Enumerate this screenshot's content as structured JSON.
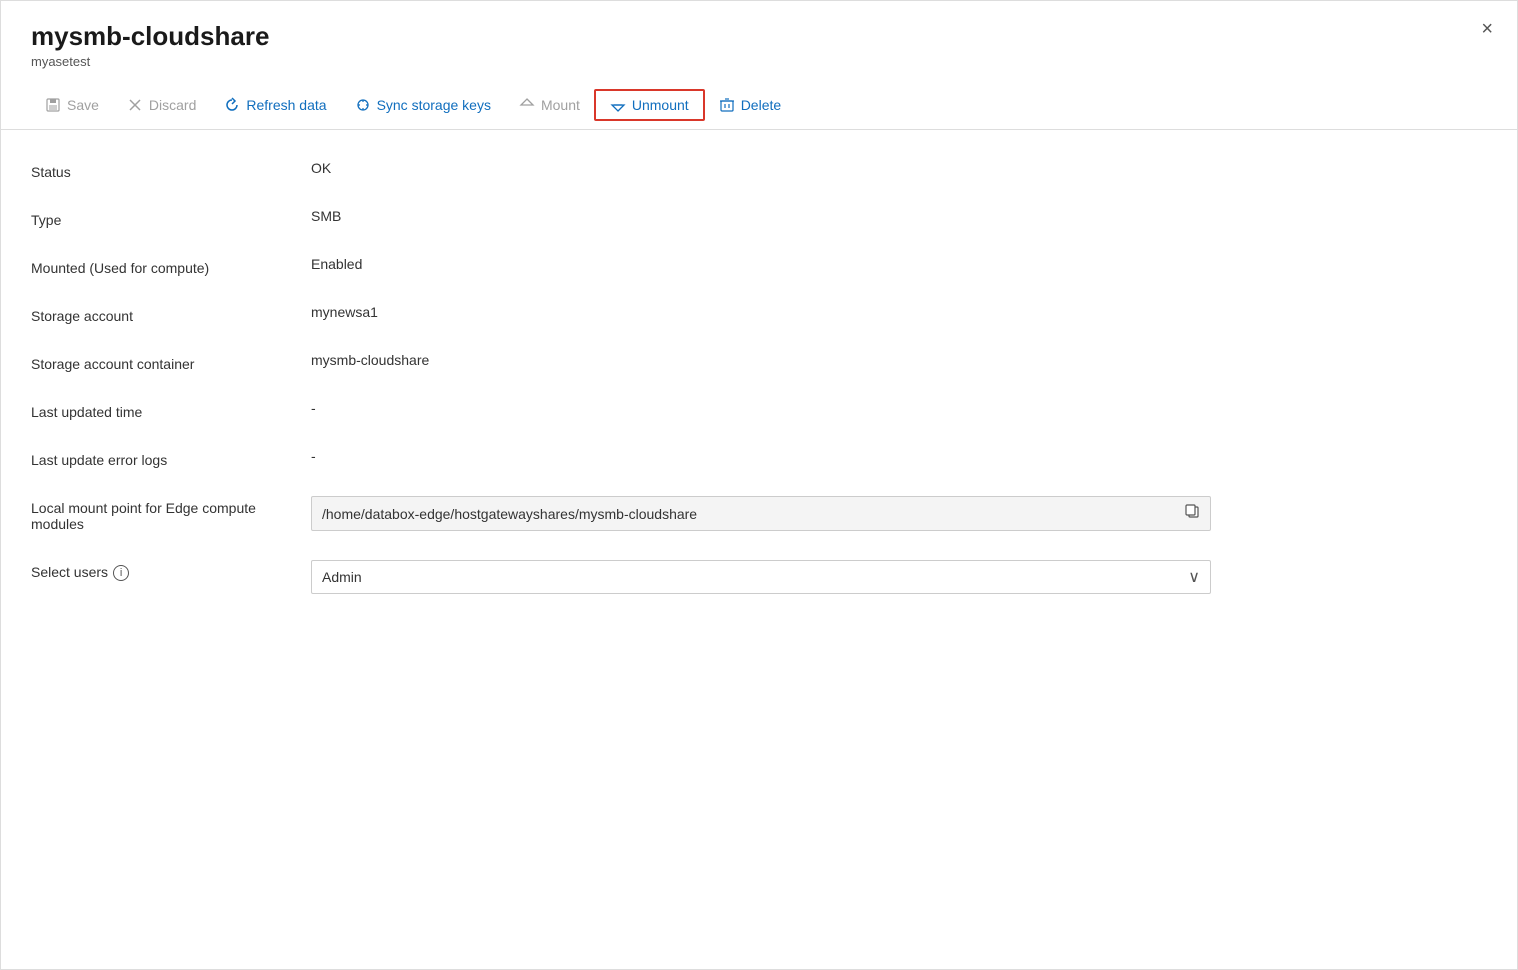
{
  "panel": {
    "title": "mysmb-cloudshare",
    "subtitle": "myasetest",
    "close_label": "×"
  },
  "toolbar": {
    "save_label": "Save",
    "discard_label": "Discard",
    "refresh_label": "Refresh data",
    "sync_label": "Sync storage keys",
    "mount_label": "Mount",
    "unmount_label": "Unmount",
    "delete_label": "Delete"
  },
  "fields": [
    {
      "label": "Status",
      "value": "OK",
      "type": "text"
    },
    {
      "label": "Type",
      "value": "SMB",
      "type": "text"
    },
    {
      "label": "Mounted (Used for compute)",
      "value": "Enabled",
      "type": "text"
    },
    {
      "label": "Storage account",
      "value": "mynewsa1",
      "type": "text"
    },
    {
      "label": "Storage account container",
      "value": "mysmb-cloudshare",
      "type": "text"
    },
    {
      "label": "Last updated time",
      "value": "-",
      "type": "text"
    },
    {
      "label": "Last update error logs",
      "value": "-",
      "type": "text"
    },
    {
      "label": "Local mount point for Edge compute modules",
      "value": "/home/databox-edge/hostgatewayshares/mysmb-cloudshare",
      "type": "readonly-box"
    },
    {
      "label": "Select users",
      "value": "Admin",
      "type": "select",
      "has_info": true
    }
  ],
  "colors": {
    "accent": "#106ebe",
    "highlight_border": "#d9372a",
    "disabled": "#a0a0a0"
  }
}
